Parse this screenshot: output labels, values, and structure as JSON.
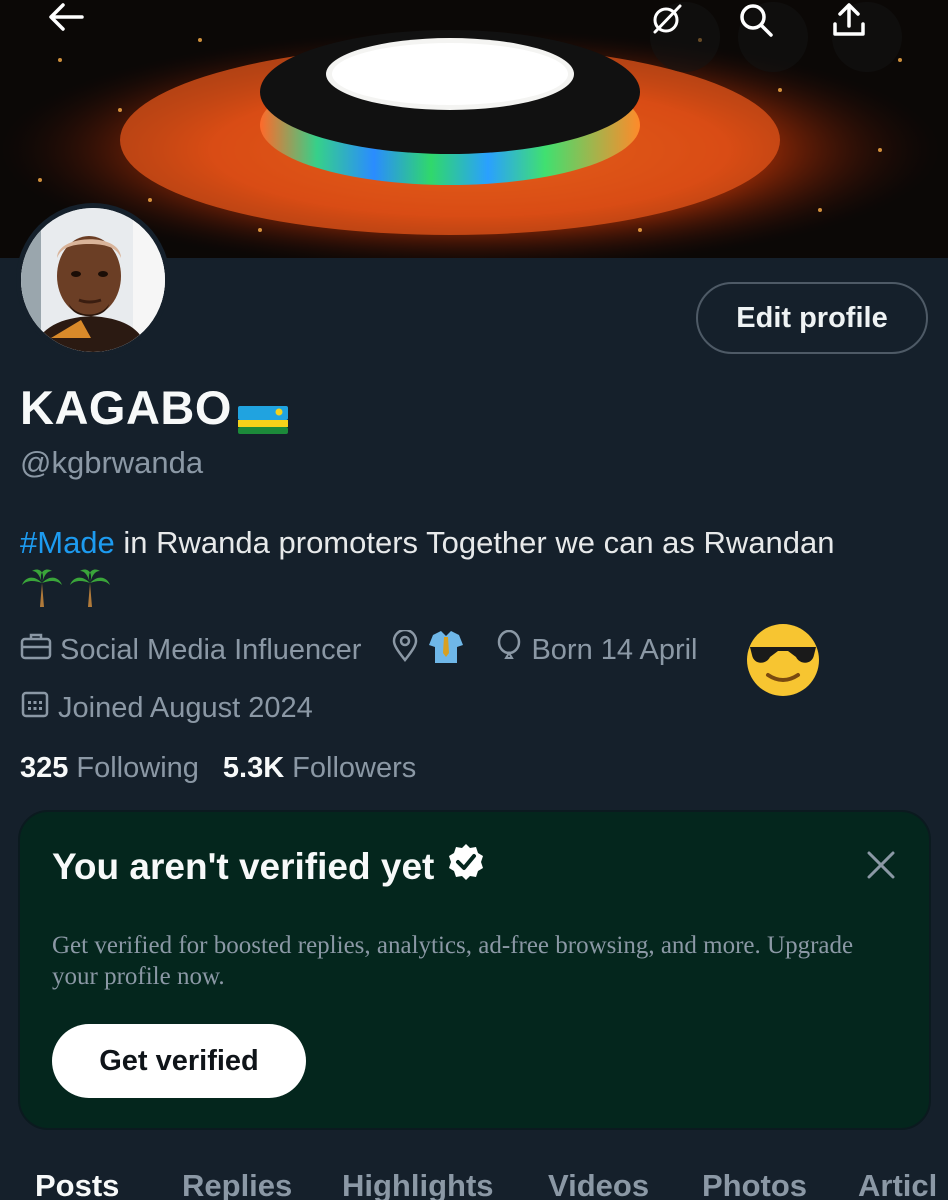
{
  "header": {
    "back_icon": "arrow-left-icon",
    "grok_icon": "grok-icon",
    "search_icon": "search-icon",
    "share_icon": "share-icon"
  },
  "profile": {
    "name": "KAGABO",
    "handle": "@kgbrwanda",
    "edit_label": "Edit profile",
    "bio_hashtag": "#Made",
    "bio_text": " in Rwanda promoters Together we can as Rwandan",
    "bio_emoji": "palm-tree-icons",
    "flag": "rwanda-flag-icon"
  },
  "meta": {
    "category": "Social Media Influencer",
    "location_emoji": "necktie-shirt-emoji",
    "born": "Born 14 April",
    "joined": "Joined August 2024"
  },
  "stats": {
    "following_count": "325",
    "following_label": "Following",
    "followers_count": "5.3K",
    "followers_label": "Followers"
  },
  "verify": {
    "title": "You aren't verified yet",
    "text": "Get verified for boosted replies, analytics, ad-free browsing, and more. Upgrade your profile now.",
    "button": "Get verified"
  },
  "tabs": [
    "Posts",
    "Replies",
    "Highlights",
    "Videos",
    "Photos",
    "Articl"
  ],
  "colors": {
    "background": "#15202b",
    "accent": "#1d9bf0",
    "verify_bg": "#04261d",
    "muted": "#8b98a5"
  }
}
